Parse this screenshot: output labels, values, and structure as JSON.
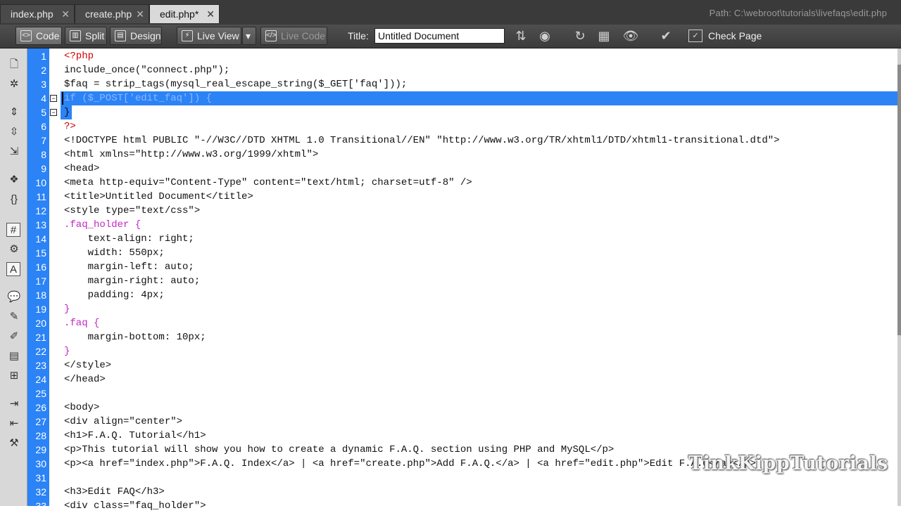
{
  "tabs": [
    {
      "label": "index.php",
      "close": "✕"
    },
    {
      "label": "create.php",
      "close": "✕"
    },
    {
      "label": "edit.php*",
      "close": "✕"
    }
  ],
  "path": "Path:  C:\\webroot\\tutorials\\livefaqs\\edit.php",
  "toolbar": {
    "code": "Code",
    "split": "Split",
    "design": "Design",
    "live_view": "Live View",
    "live_code": "Live Code",
    "title_label": "Title:",
    "title_value": "Untitled Document",
    "check_page": "Check Page"
  },
  "icons": {
    "code": "code-view-icon",
    "split": "split-view-icon",
    "design": "design-view-icon",
    "live_view": "live-view-icon",
    "live_code": "live-code-icon"
  },
  "colors": {
    "gutter": "#2b83f6",
    "selection": "#2b83f6",
    "php_tag": "#cc0000",
    "string": "#1d1dbf",
    "css": "#c228c2"
  },
  "code_lines": [
    "<?php",
    "include_once(\"connect.php\");",
    "$faq = strip_tags(mysql_real_escape_string($_GET['faq']));",
    "if ($_POST['edit_faq']) {",
    "}",
    "?>",
    "<!DOCTYPE html PUBLIC \"-//W3C//DTD XHTML 1.0 Transitional//EN\" \"http://www.w3.org/TR/xhtml1/DTD/xhtml1-transitional.dtd\">",
    "<html xmlns=\"http://www.w3.org/1999/xhtml\">",
    "<head>",
    "<meta http-equiv=\"Content-Type\" content=\"text/html; charset=utf-8\" />",
    "<title>Untitled Document</title>",
    "<style type=\"text/css\">",
    ".faq_holder {",
    "    text-align: right;",
    "    width: 550px;",
    "    margin-left: auto;",
    "    margin-right: auto;",
    "    padding: 4px;",
    "}",
    ".faq {",
    "    margin-bottom: 10px;",
    "}",
    "</style>",
    "</head>",
    "",
    "<body>",
    "<div align=\"center\">",
    "<h1>F.A.Q. Tutorial</h1>",
    "<p>This tutorial will show you how to create a dynamic F.A.Q. section using PHP and MySQL</p>",
    "<p><a href=\"index.php\">F.A.Q. Index</a> | <a href=\"create.php\">Add F.A.Q.</a> | <a href=\"edit.php\">Edit F.A.Q</a></p>",
    "",
    "<h3>Edit FAQ</h3>",
    "<div class=\"faq_holder\">"
  ],
  "watermark": "TinkKippTutorials"
}
